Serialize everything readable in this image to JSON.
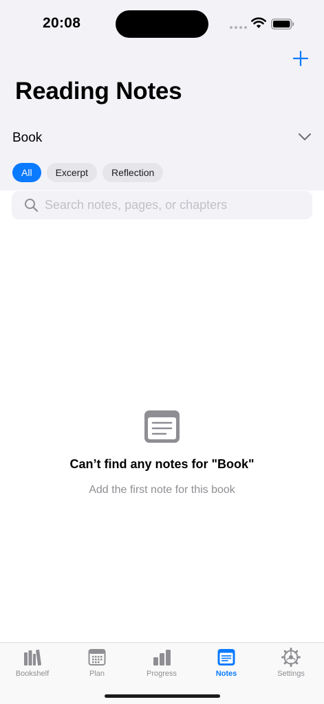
{
  "status_bar": {
    "time": "20:08"
  },
  "header": {
    "title": "Reading Notes",
    "add_icon": "plus-icon"
  },
  "book_selector": {
    "label": "Book",
    "icon": "chevron-down-icon"
  },
  "filters": {
    "chips": [
      "All",
      "Excerpt",
      "Reflection"
    ],
    "selected": "All"
  },
  "search": {
    "placeholder": "Search notes, pages, or chapters",
    "value": ""
  },
  "empty_state": {
    "icon": "note-icon",
    "title": "Can’t find any notes for \"Book\"",
    "subtitle": "Add the first note for this book"
  },
  "tab_bar": {
    "tabs": [
      {
        "label": "Bookshelf",
        "icon": "bookshelf-icon"
      },
      {
        "label": "Plan",
        "icon": "calendar-icon"
      },
      {
        "label": "Progress",
        "icon": "bar-chart-icon"
      },
      {
        "label": "Notes",
        "icon": "notes-icon"
      },
      {
        "label": "Settings",
        "icon": "gear-icon"
      }
    ],
    "active": "Notes"
  },
  "colors": {
    "accent": "#0a7aff",
    "header_bg": "#f2f2f7",
    "inactive": "#8e8e93"
  }
}
